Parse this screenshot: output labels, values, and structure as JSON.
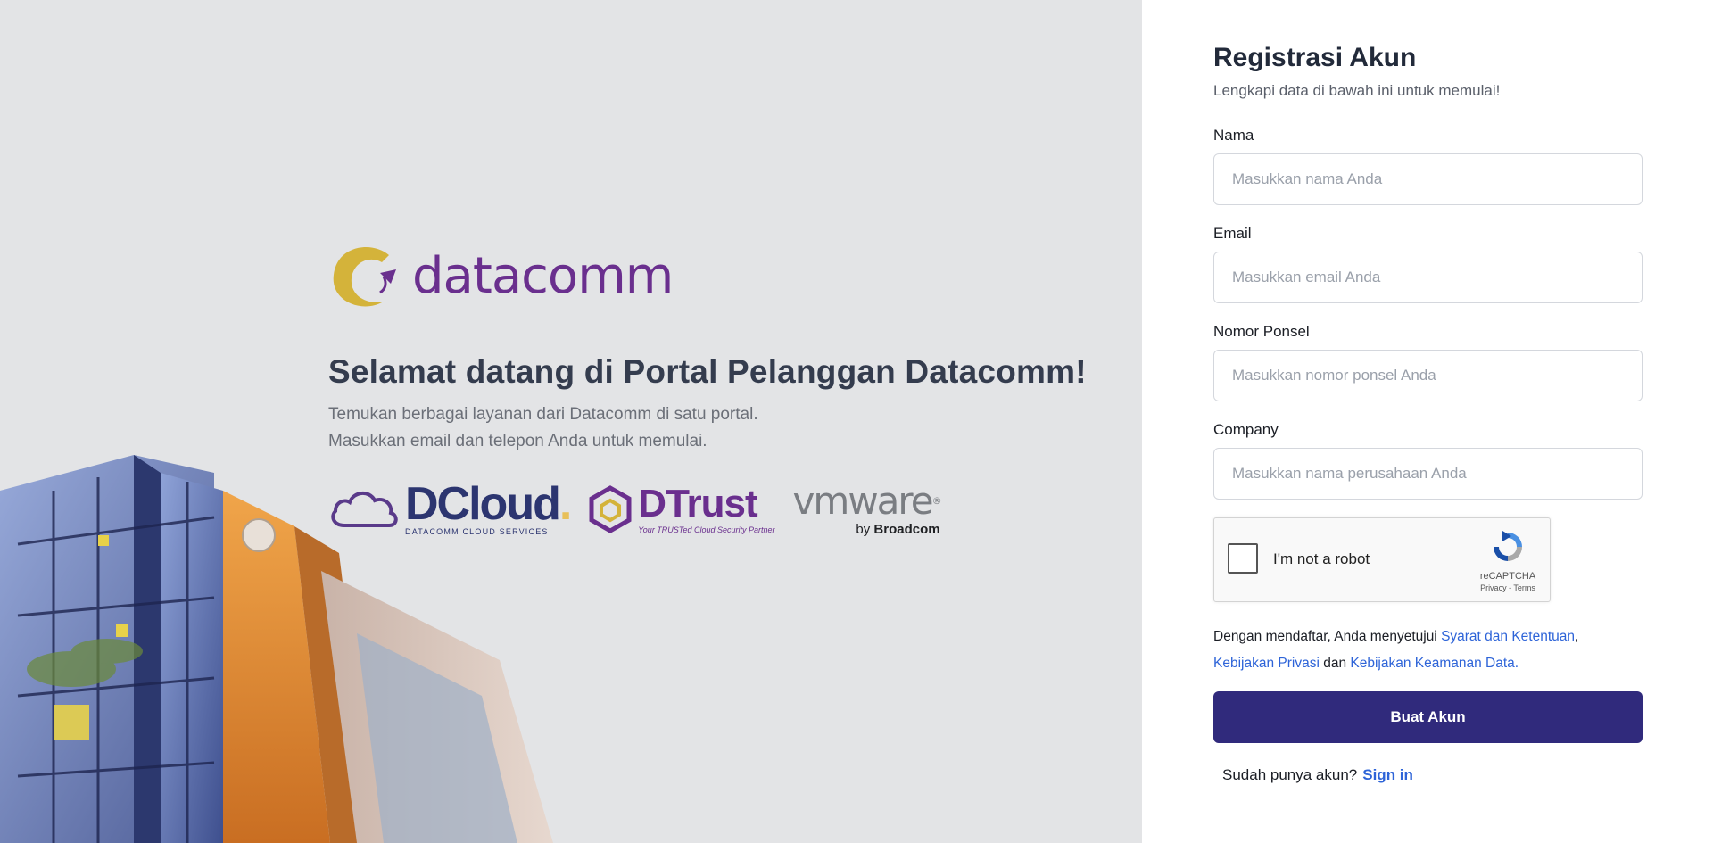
{
  "brand": {
    "logo_text": "datacomm"
  },
  "hero": {
    "welcome": "Selamat datang di Portal Pelanggan Datacomm!",
    "sub_line1": "Temukan berbagai layanan dari Datacomm di satu portal.",
    "sub_line2": "Masukkan email dan telepon Anda untuk memulai."
  },
  "partners": {
    "dcloud_word": "DCloud",
    "dcloud_tag": "DATACOMM CLOUD SERVICES",
    "dtrust_word": "DTrust",
    "dtrust_tag": "Your TRUSTed Cloud Security Partner",
    "vmware_word": "vmware",
    "vmware_by": "by",
    "vmware_broadcom": "Broadcom"
  },
  "form": {
    "title": "Registrasi Akun",
    "subtitle": "Lengkapi data di bawah ini untuk memulai!",
    "fields": [
      {
        "label": "Nama",
        "placeholder": "Masukkan nama Anda"
      },
      {
        "label": "Email",
        "placeholder": "Masukkan email Anda"
      },
      {
        "label": "Nomor Ponsel",
        "placeholder": "Masukkan nomor ponsel Anda"
      },
      {
        "label": "Company",
        "placeholder": "Masukkan nama perusahaan Anda"
      }
    ],
    "captcha": {
      "label": "I'm not a robot",
      "brand": "reCAPTCHA",
      "privacy": "Privacy",
      "sep": " - ",
      "terms": "Terms"
    },
    "terms": {
      "prefix": "Dengan mendaftar, Anda menyetujui ",
      "link1": "Syarat dan Ketentuan",
      "comma": ",",
      "link2": "Kebijakan Privasi",
      "and": " dan ",
      "link3": "Kebijakan Keamanan Data."
    },
    "submit_label": "Buat Akun",
    "signin_prompt": "Sudah punya akun?",
    "signin_link": "Sign in"
  },
  "colors": {
    "brand_purple": "#6a2f8e",
    "brand_gold": "#d4b33a",
    "button": "#302a7c",
    "link": "#2e64d8"
  }
}
